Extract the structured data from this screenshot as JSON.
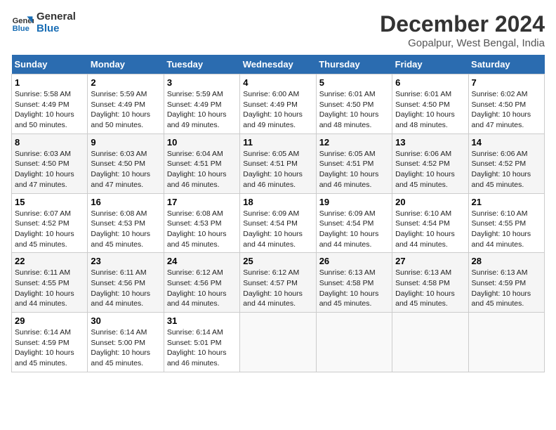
{
  "logo": {
    "line1": "General",
    "line2": "Blue"
  },
  "title": "December 2024",
  "location": "Gopalpur, West Bengal, India",
  "days_header": [
    "Sunday",
    "Monday",
    "Tuesday",
    "Wednesday",
    "Thursday",
    "Friday",
    "Saturday"
  ],
  "weeks": [
    [
      {
        "day": "1",
        "text": "Sunrise: 5:58 AM\nSunset: 4:49 PM\nDaylight: 10 hours\nand 50 minutes."
      },
      {
        "day": "2",
        "text": "Sunrise: 5:59 AM\nSunset: 4:49 PM\nDaylight: 10 hours\nand 50 minutes."
      },
      {
        "day": "3",
        "text": "Sunrise: 5:59 AM\nSunset: 4:49 PM\nDaylight: 10 hours\nand 49 minutes."
      },
      {
        "day": "4",
        "text": "Sunrise: 6:00 AM\nSunset: 4:49 PM\nDaylight: 10 hours\nand 49 minutes."
      },
      {
        "day": "5",
        "text": "Sunrise: 6:01 AM\nSunset: 4:50 PM\nDaylight: 10 hours\nand 48 minutes."
      },
      {
        "day": "6",
        "text": "Sunrise: 6:01 AM\nSunset: 4:50 PM\nDaylight: 10 hours\nand 48 minutes."
      },
      {
        "day": "7",
        "text": "Sunrise: 6:02 AM\nSunset: 4:50 PM\nDaylight: 10 hours\nand 47 minutes."
      }
    ],
    [
      {
        "day": "8",
        "text": "Sunrise: 6:03 AM\nSunset: 4:50 PM\nDaylight: 10 hours\nand 47 minutes."
      },
      {
        "day": "9",
        "text": "Sunrise: 6:03 AM\nSunset: 4:50 PM\nDaylight: 10 hours\nand 47 minutes."
      },
      {
        "day": "10",
        "text": "Sunrise: 6:04 AM\nSunset: 4:51 PM\nDaylight: 10 hours\nand 46 minutes."
      },
      {
        "day": "11",
        "text": "Sunrise: 6:05 AM\nSunset: 4:51 PM\nDaylight: 10 hours\nand 46 minutes."
      },
      {
        "day": "12",
        "text": "Sunrise: 6:05 AM\nSunset: 4:51 PM\nDaylight: 10 hours\nand 46 minutes."
      },
      {
        "day": "13",
        "text": "Sunrise: 6:06 AM\nSunset: 4:52 PM\nDaylight: 10 hours\nand 45 minutes."
      },
      {
        "day": "14",
        "text": "Sunrise: 6:06 AM\nSunset: 4:52 PM\nDaylight: 10 hours\nand 45 minutes."
      }
    ],
    [
      {
        "day": "15",
        "text": "Sunrise: 6:07 AM\nSunset: 4:52 PM\nDaylight: 10 hours\nand 45 minutes."
      },
      {
        "day": "16",
        "text": "Sunrise: 6:08 AM\nSunset: 4:53 PM\nDaylight: 10 hours\nand 45 minutes."
      },
      {
        "day": "17",
        "text": "Sunrise: 6:08 AM\nSunset: 4:53 PM\nDaylight: 10 hours\nand 45 minutes."
      },
      {
        "day": "18",
        "text": "Sunrise: 6:09 AM\nSunset: 4:54 PM\nDaylight: 10 hours\nand 44 minutes."
      },
      {
        "day": "19",
        "text": "Sunrise: 6:09 AM\nSunset: 4:54 PM\nDaylight: 10 hours\nand 44 minutes."
      },
      {
        "day": "20",
        "text": "Sunrise: 6:10 AM\nSunset: 4:54 PM\nDaylight: 10 hours\nand 44 minutes."
      },
      {
        "day": "21",
        "text": "Sunrise: 6:10 AM\nSunset: 4:55 PM\nDaylight: 10 hours\nand 44 minutes."
      }
    ],
    [
      {
        "day": "22",
        "text": "Sunrise: 6:11 AM\nSunset: 4:55 PM\nDaylight: 10 hours\nand 44 minutes."
      },
      {
        "day": "23",
        "text": "Sunrise: 6:11 AM\nSunset: 4:56 PM\nDaylight: 10 hours\nand 44 minutes."
      },
      {
        "day": "24",
        "text": "Sunrise: 6:12 AM\nSunset: 4:56 PM\nDaylight: 10 hours\nand 44 minutes."
      },
      {
        "day": "25",
        "text": "Sunrise: 6:12 AM\nSunset: 4:57 PM\nDaylight: 10 hours\nand 44 minutes."
      },
      {
        "day": "26",
        "text": "Sunrise: 6:13 AM\nSunset: 4:58 PM\nDaylight: 10 hours\nand 45 minutes."
      },
      {
        "day": "27",
        "text": "Sunrise: 6:13 AM\nSunset: 4:58 PM\nDaylight: 10 hours\nand 45 minutes."
      },
      {
        "day": "28",
        "text": "Sunrise: 6:13 AM\nSunset: 4:59 PM\nDaylight: 10 hours\nand 45 minutes."
      }
    ],
    [
      {
        "day": "29",
        "text": "Sunrise: 6:14 AM\nSunset: 4:59 PM\nDaylight: 10 hours\nand 45 minutes."
      },
      {
        "day": "30",
        "text": "Sunrise: 6:14 AM\nSunset: 5:00 PM\nDaylight: 10 hours\nand 45 minutes."
      },
      {
        "day": "31",
        "text": "Sunrise: 6:14 AM\nSunset: 5:01 PM\nDaylight: 10 hours\nand 46 minutes."
      },
      null,
      null,
      null,
      null
    ]
  ]
}
